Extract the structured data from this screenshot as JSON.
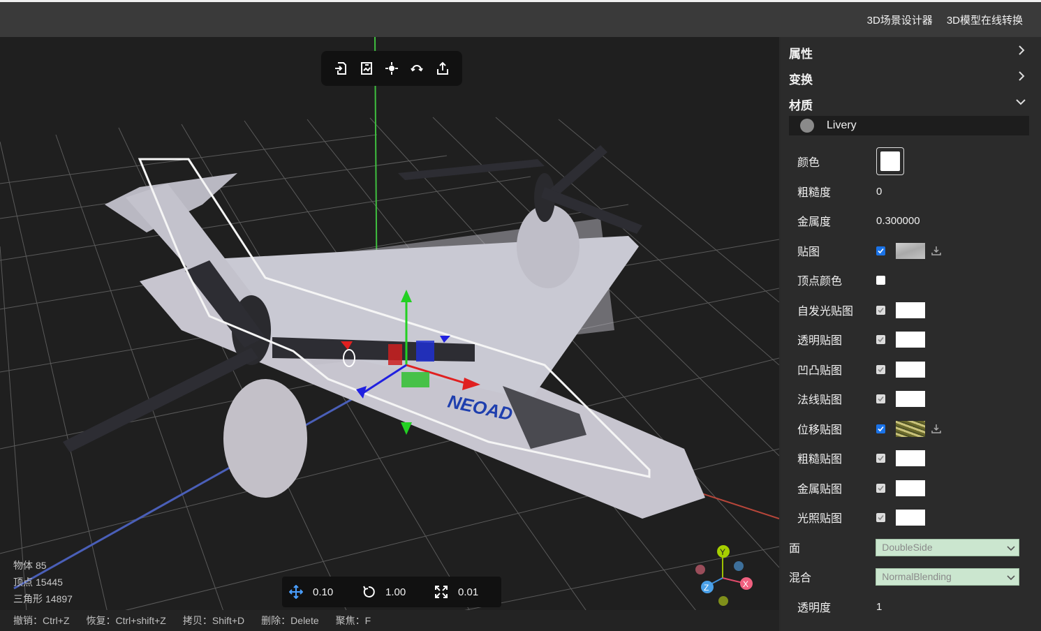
{
  "header": {
    "links": [
      "3D场景设计器",
      "3D模型在线转换"
    ]
  },
  "viewport": {
    "toolbar_icons": [
      "import-icon",
      "export-image-icon",
      "center-icon",
      "reset-view-icon",
      "share-icon"
    ],
    "stats": {
      "objects_label": "物体",
      "objects_value": "85",
      "vertices_label": "顶点",
      "vertices_value": "15445",
      "triangles_label": "三角形",
      "triangles_value": "14897"
    },
    "snap": {
      "translate": "0.10",
      "rotate": "1.00",
      "scale": "0.01"
    },
    "shortcuts": [
      "撤销：Ctrl+Z",
      "恢复：Ctrl+shift+Z",
      "拷贝：Shift+D",
      "删除：Delete",
      "聚焦：F"
    ],
    "gizmo_axes": [
      "Y",
      "X",
      "Z"
    ],
    "model_logo_text": "NEOAD"
  },
  "sidebar": {
    "sections": {
      "properties": "属性",
      "transform": "变换",
      "material": "材质"
    },
    "material_name": "Livery",
    "fields": {
      "color": "颜色",
      "roughness_label": "粗糙度",
      "roughness_value": "0",
      "metalness_label": "金属度",
      "metalness_value": "0.300000",
      "map": "贴图",
      "vertex_colors": "顶点颜色",
      "emissive_map": "自发光贴图",
      "alpha_map": "透明贴图",
      "bump_map": "凹凸贴图",
      "normal_map": "法线贴图",
      "displacement_map": "位移贴图",
      "roughness_map": "粗糙贴图",
      "metalness_map": "金属贴图",
      "light_map": "光照贴图",
      "side_label": "面",
      "side_value": "DoubleSide",
      "blending_label": "混合",
      "blending_value": "NormalBlending",
      "opacity_label": "透明度",
      "opacity_value": "1"
    }
  }
}
